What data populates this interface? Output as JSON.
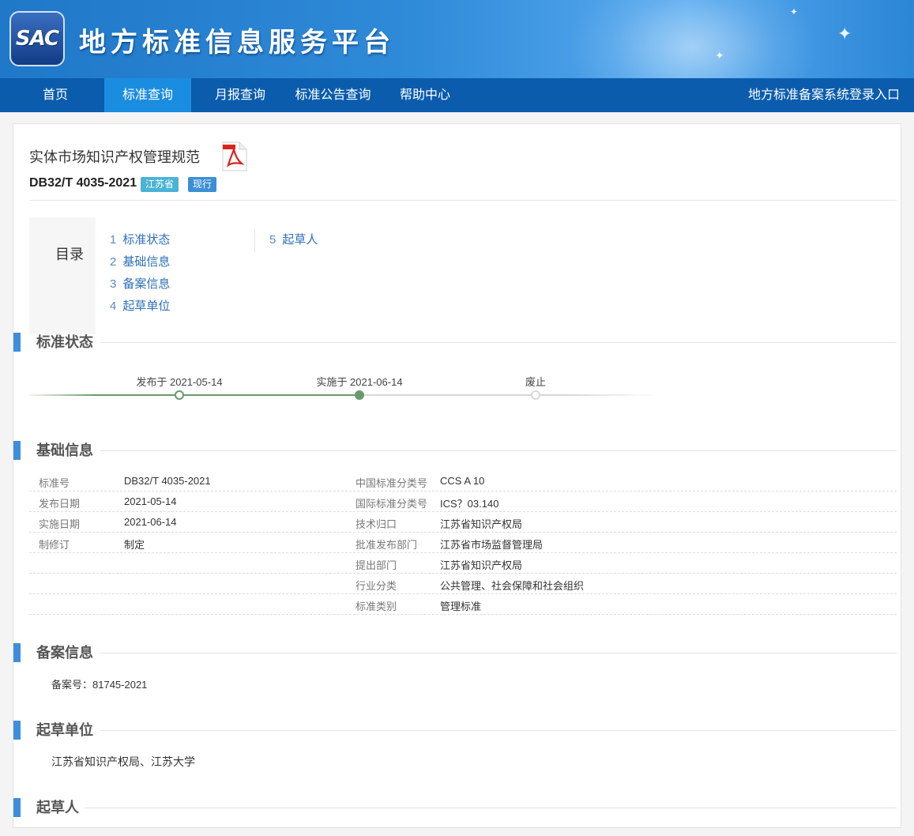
{
  "header": {
    "logo_text": "SAC",
    "site_title": "地方标准信息服务平台"
  },
  "nav": {
    "items": [
      {
        "label": "首页"
      },
      {
        "label": "标准查询"
      },
      {
        "label": "月报查询"
      },
      {
        "label": "标准公告查询"
      },
      {
        "label": "帮助中心"
      }
    ],
    "active_index": 1,
    "login_label": "地方标准备案系统登录入口"
  },
  "standard": {
    "title": "实体市场知识产权管理规范",
    "code": "DB32/T 4035-2021",
    "region_tag": "江苏省",
    "status_tag": "现行"
  },
  "toc": {
    "label": "目录",
    "items": [
      {
        "num": "1",
        "label": "标准状态"
      },
      {
        "num": "2",
        "label": "基础信息"
      },
      {
        "num": "3",
        "label": "备案信息"
      },
      {
        "num": "4",
        "label": "起草单位"
      },
      {
        "num": "5",
        "label": "起草人"
      }
    ]
  },
  "sections": {
    "status": "标准状态",
    "basic": "基础信息",
    "filing": "备案信息",
    "drafting_unit": "起草单位",
    "drafters": "起草人"
  },
  "timeline": {
    "publish": "发布于 2021-05-14",
    "implement": "实施于 2021-06-14",
    "abolish": "废止",
    "colors": {
      "done": "#6a9a6a",
      "pending": "#d8d8d8"
    }
  },
  "basic_info": {
    "left": [
      {
        "key": "标准号",
        "value": "DB32/T 4035-2021"
      },
      {
        "key": "发布日期",
        "value": "2021-05-14"
      },
      {
        "key": "实施日期",
        "value": "2021-06-14"
      },
      {
        "key": "制修订",
        "value": "制定"
      }
    ],
    "right": [
      {
        "key": "中国标准分类号",
        "value": "CCS A 10"
      },
      {
        "key": "国际标准分类号",
        "value": "ICS？03.140"
      },
      {
        "key": "技术归口",
        "value": "江苏省知识产权局"
      },
      {
        "key": "批准发布部门",
        "value": "江苏省市场监督管理局"
      },
      {
        "key": "提出部门",
        "value": "江苏省知识产权局"
      },
      {
        "key": "行业分类",
        "value": "公共管理、社会保障和社会组织"
      },
      {
        "key": "标准类别",
        "value": "管理标准"
      }
    ]
  },
  "filing": {
    "text": "备案号：81745-2021"
  },
  "drafting_unit": {
    "text": "江苏省知识产权局、江苏大学"
  },
  "colors": {
    "accent": "#3d8fdb",
    "nav_bg": "#0b5cad",
    "nav_active": "#1b8de0"
  }
}
